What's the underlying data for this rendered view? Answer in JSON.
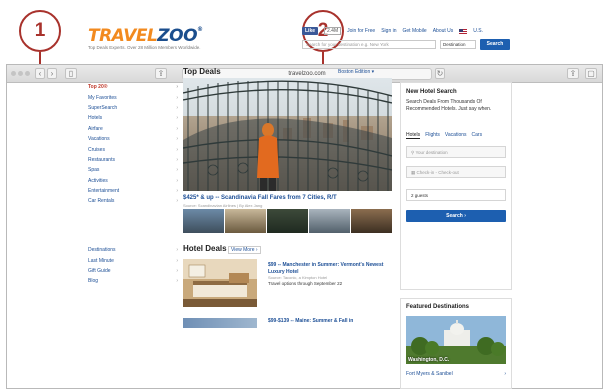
{
  "callouts": [
    "1",
    "2"
  ],
  "browser": {
    "url": "travelzoo.com",
    "nav_back": "‹",
    "nav_forward": "›",
    "sidebar_btn": "▯",
    "share_btn": "⇪",
    "tabs_btn": "▢",
    "reload_btn": "↻",
    "lock": "🔒"
  },
  "site": {
    "logo_travel": "TRAVEL",
    "logo_zoo": "ZOO",
    "logo_reg": "®",
    "tagline": "Top Deals Experts. Over 28 Million Members Worldwide.",
    "like": "Like",
    "like_count": "2.4M",
    "links": [
      "Join for Free",
      "Sign in",
      "Get Mobile",
      "About Us"
    ],
    "locale": "U.S.",
    "search_placeholder": "Search for your destination e.g. New York",
    "destination": "Destination",
    "search_btn": "Search"
  },
  "sidebar": {
    "items": [
      "Top 20®",
      "My Favorites",
      "SuperSearch",
      "Hotels",
      "Airfare",
      "Vacations",
      "Cruises",
      "Restaurants",
      "Spas",
      "Activities",
      "Entertainment",
      "Car Rentals"
    ],
    "items2": [
      "Destinations",
      "Last Minute",
      "Gift Guide",
      "Blog"
    ],
    "chevron": "›"
  },
  "top_deals": {
    "title": "Top Deals",
    "edition": "Boston Edition",
    "edition_caret": "▾",
    "deal_title": "$425* & up -- Scandinavia Fall Fares from 7 Cities, R/T",
    "deal_source": "Source: Scandinavian Airlines | By Alex Jang"
  },
  "hotel_deals": {
    "title": "Hotel Deals",
    "view_more": "View More ›",
    "item1_title": "$99 -- Manchester in Summer: Vermont's Newest Luxury Hotel",
    "item1_sub": "Source: Taconic, a Kimpton Hotel",
    "item1_desc": "Travel options through September 22",
    "item2_title": "$99-$139 -- Maine: Summer & Fall in"
  },
  "hotel_search": {
    "title": "New Hotel Search",
    "desc": "Search Deals From Thousands Of Recommended Hotels. Just say when.",
    "tabs": [
      "Hotels",
      "Flights",
      "Vacations",
      "Cars"
    ],
    "destination_placeholder": "Your destination",
    "dates_placeholder": "Check-in - Check-out",
    "guests": "2 guests",
    "search_btn": "Search ›"
  },
  "featured": {
    "title": "Featured Destinations",
    "image_label": "Washington, D.C.",
    "link": "Fort Myers & Sanibel",
    "link_chevron": "›"
  }
}
